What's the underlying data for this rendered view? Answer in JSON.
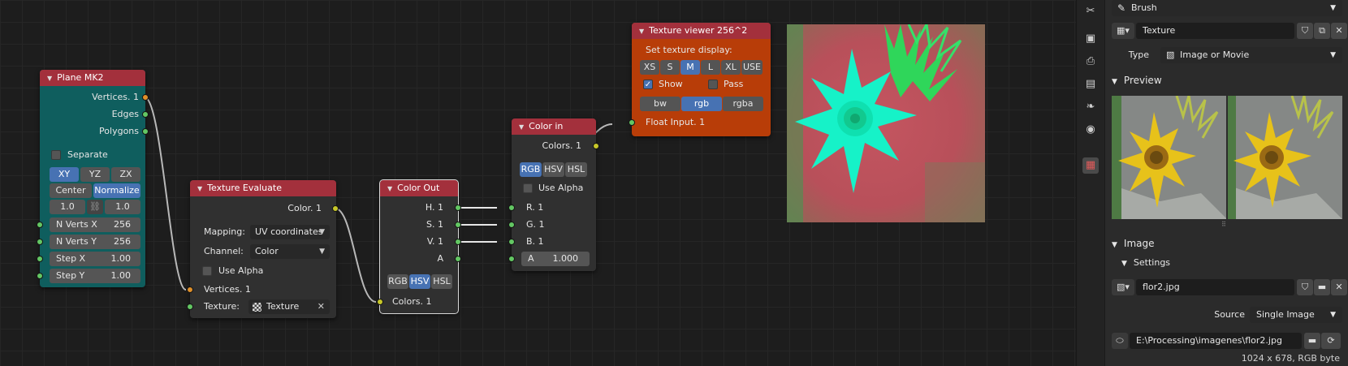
{
  "nodes": {
    "plane": {
      "title": "Plane MK2",
      "outputs": [
        "Vertices. 1",
        "Edges",
        "Polygons"
      ],
      "separate_label": "Separate",
      "axes": [
        "XY",
        "YZ",
        "ZX"
      ],
      "center_label": "Center",
      "normalize_label": "Normalize",
      "size_x": "1.0",
      "size_y": "1.0",
      "nverts_x_label": "N Verts X",
      "nverts_x_value": "256",
      "nverts_y_label": "N Verts Y",
      "nverts_y_value": "256",
      "step_x_label": "Step X",
      "step_x_value": "1.00",
      "step_y_label": "Step Y",
      "step_y_value": "1.00"
    },
    "texture_evaluate": {
      "title": "Texture Evaluate",
      "output": "Color. 1",
      "mapping_label": "Mapping:",
      "mapping_value": "UV coordinates",
      "channel_label": "Channel:",
      "channel_value": "Color",
      "use_alpha_label": "Use Alpha",
      "vertices_label": "Vertices. 1",
      "texture_label": "Texture:",
      "texture_value": "Texture"
    },
    "color_out": {
      "title": "Color Out",
      "outputs": [
        "H. 1",
        "S. 1",
        "V. 1",
        "A"
      ],
      "modes": [
        "RGB",
        "HSV",
        "HSL"
      ],
      "active_mode": "HSV",
      "input": "Colors. 1"
    },
    "color_in": {
      "title": "Color in",
      "output": "Colors. 1",
      "modes": [
        "RGB",
        "HSV",
        "HSL"
      ],
      "active_mode": "RGB",
      "use_alpha_label": "Use Alpha",
      "inputs": [
        "R. 1",
        "G. 1",
        "B. 1"
      ],
      "alpha_label": "A",
      "alpha_value": "1.000"
    },
    "texture_viewer": {
      "title": "Texture viewer 256^2",
      "set_display_label": "Set texture display:",
      "sizes": [
        "XS",
        "S",
        "M",
        "L",
        "XL",
        "USE"
      ],
      "active_size": "M",
      "show_label": "Show",
      "pass_label": "Pass",
      "color_modes": [
        "bw",
        "rgb",
        "rgba"
      ],
      "active_color_mode": "rgb",
      "input": "Float Input. 1"
    }
  },
  "properties": {
    "brush_label": "Brush",
    "texture_name": "Texture",
    "type_label": "Type",
    "type_value": "Image or Movie",
    "preview_header": "Preview",
    "image_header": "Image",
    "settings_header": "Settings",
    "image_name": "flor2.jpg",
    "source_label": "Source",
    "source_value": "Single Image",
    "filepath": "E:\\Processing\\imagenes\\flor2.jpg",
    "image_info": "1024 x 678,  RGB byte"
  },
  "colors": {
    "node_header_red": "#a3303c",
    "plane_body_teal": "#0f5e5e",
    "viewer_body_orange": "#b83d08",
    "active_blue": "#4772b3",
    "socket_green": "#63c763",
    "socket_yellow": "#c7c729",
    "socket_orange": "#e0902a"
  }
}
